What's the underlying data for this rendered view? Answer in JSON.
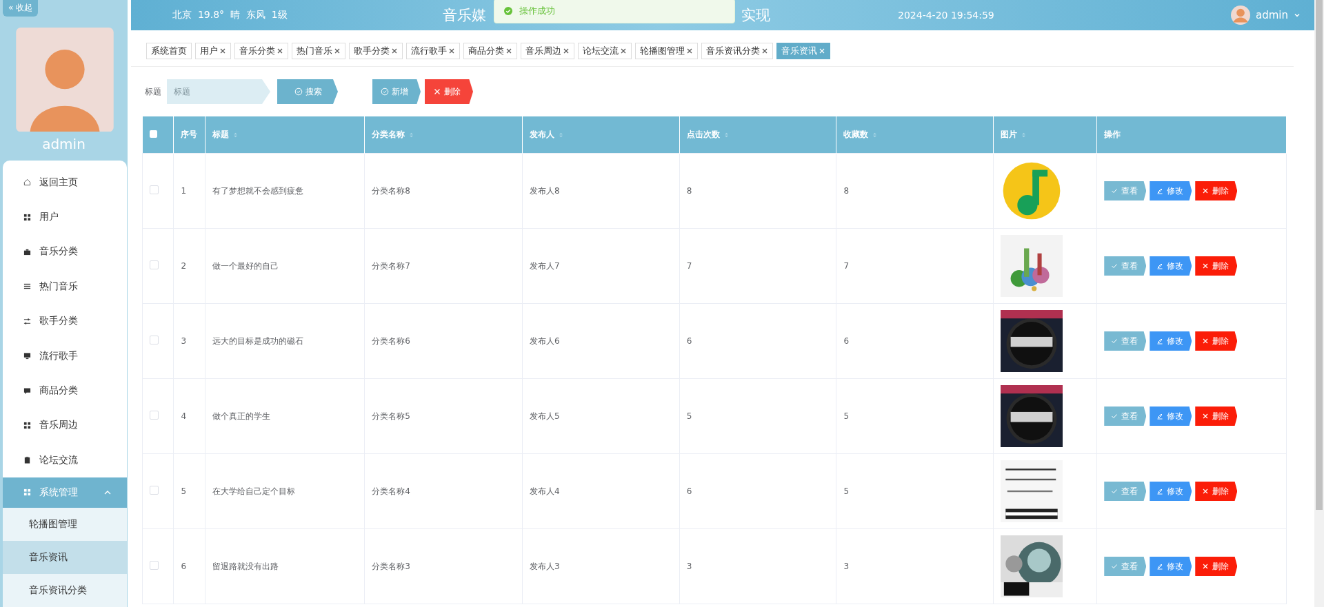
{
  "sidebar": {
    "collapse_button": "« 收起",
    "user_name": "admin",
    "menu": [
      {
        "label": "返回主页",
        "selected": false
      },
      {
        "label": "用户",
        "selected": false
      },
      {
        "label": "音乐分类",
        "selected": false
      },
      {
        "label": "热门音乐",
        "selected": false
      },
      {
        "label": "歌手分类",
        "selected": false
      },
      {
        "label": "流行歌手",
        "selected": false
      },
      {
        "label": "商品分类",
        "selected": false
      },
      {
        "label": "音乐周边",
        "selected": false
      },
      {
        "label": "论坛交流",
        "selected": false
      },
      {
        "label": "系统管理",
        "expanded": true,
        "children": [
          {
            "label": "轮播图管理",
            "selected": false
          },
          {
            "label": "音乐资讯",
            "selected": true
          },
          {
            "label": "音乐资讯分类",
            "selected": false
          }
        ]
      }
    ]
  },
  "header": {
    "weather": "北京  19.8°  晴  东风  1级",
    "title_start": "音乐媒",
    "title_end": "实现",
    "datetime": "2024-4-20 19:54:59",
    "user": "admin"
  },
  "toast": {
    "message": "操作成功"
  },
  "tabs": [
    {
      "label": "系统首页",
      "closable": false,
      "selected": false
    },
    {
      "label": "用户",
      "closable": true,
      "selected": false
    },
    {
      "label": "音乐分类",
      "closable": true,
      "selected": false
    },
    {
      "label": "热门音乐",
      "closable": true,
      "selected": false
    },
    {
      "label": "歌手分类",
      "closable": true,
      "selected": false
    },
    {
      "label": "流行歌手",
      "closable": true,
      "selected": false
    },
    {
      "label": "商品分类",
      "closable": true,
      "selected": false
    },
    {
      "label": "音乐周边",
      "closable": true,
      "selected": false
    },
    {
      "label": "论坛交流",
      "closable": true,
      "selected": false
    },
    {
      "label": "轮播图管理",
      "closable": true,
      "selected": false
    },
    {
      "label": "音乐资讯分类",
      "closable": true,
      "selected": false
    },
    {
      "label": "音乐资讯",
      "closable": true,
      "selected": true
    }
  ],
  "search": {
    "label": "标题",
    "placeholder": "标题",
    "search_button": "搜索",
    "add_button": "新增",
    "delete_button": "删除"
  },
  "table": {
    "select_all_checked": false,
    "columns": [
      {
        "label": "序号",
        "sortable": false
      },
      {
        "label": "标题",
        "sortable": true
      },
      {
        "label": "分类名称",
        "sortable": true
      },
      {
        "label": "发布人",
        "sortable": true
      },
      {
        "label": "点击次数",
        "sortable": true
      },
      {
        "label": "收藏数",
        "sortable": true
      },
      {
        "label": "图片",
        "sortable": true
      },
      {
        "label": "操作",
        "sortable": false
      }
    ],
    "rows": [
      {
        "index": "1",
        "title": "有了梦想就不会感到疲惫",
        "category": "分类名称8",
        "publisher": "发布人8",
        "clicks": "8",
        "favorites": "8",
        "checked": false,
        "view": "查看",
        "edit": "修改",
        "delete": "删除"
      },
      {
        "index": "2",
        "title": "做一个最好的自己",
        "category": "分类名称7",
        "publisher": "发布人7",
        "clicks": "7",
        "favorites": "7",
        "checked": false,
        "view": "查看",
        "edit": "修改",
        "delete": "删除"
      },
      {
        "index": "3",
        "title": "远大的目标是成功的磁石",
        "category": "分类名称6",
        "publisher": "发布人6",
        "clicks": "6",
        "favorites": "6",
        "checked": false,
        "view": "查看",
        "edit": "修改",
        "delete": "删除"
      },
      {
        "index": "4",
        "title": "做个真正的学生",
        "category": "分类名称5",
        "publisher": "发布人5",
        "clicks": "5",
        "favorites": "5",
        "checked": false,
        "view": "查看",
        "edit": "修改",
        "delete": "删除"
      },
      {
        "index": "5",
        "title": "在大学给自己定个目标",
        "category": "分类名称4",
        "publisher": "发布人4",
        "clicks": "6",
        "favorites": "5",
        "checked": false,
        "view": "查看",
        "edit": "修改",
        "delete": "删除"
      },
      {
        "index": "6",
        "title": "留退路就没有出路",
        "category": "分类名称3",
        "publisher": "发布人3",
        "clicks": "3",
        "favorites": "3",
        "checked": false,
        "view": "查看",
        "edit": "修改",
        "delete": "删除"
      }
    ]
  }
}
